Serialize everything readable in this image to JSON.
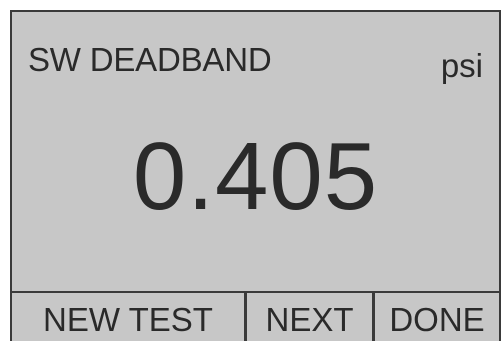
{
  "display": {
    "title": "SW DEADBAND",
    "unit": "psi",
    "reading": "0.405"
  },
  "softkeys": [
    {
      "label": "NEW TEST"
    },
    {
      "label": "NEXT"
    },
    {
      "label": "DONE"
    }
  ],
  "colors": {
    "screen_background": "#c7c7c7",
    "text": "#2a2a2a",
    "border": "#3a3a3a"
  }
}
